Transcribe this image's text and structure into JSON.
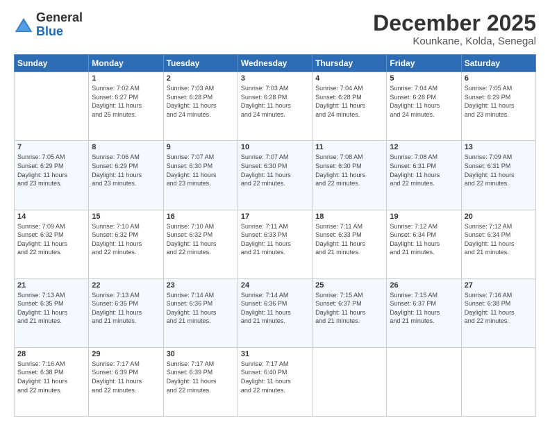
{
  "logo": {
    "line1": "General",
    "line2": "Blue"
  },
  "header": {
    "month": "December 2025",
    "location": "Kounkane, Kolda, Senegal"
  },
  "weekdays": [
    "Sunday",
    "Monday",
    "Tuesday",
    "Wednesday",
    "Thursday",
    "Friday",
    "Saturday"
  ],
  "weeks": [
    [
      {
        "day": "",
        "info": ""
      },
      {
        "day": "1",
        "info": "Sunrise: 7:02 AM\nSunset: 6:27 PM\nDaylight: 11 hours\nand 25 minutes."
      },
      {
        "day": "2",
        "info": "Sunrise: 7:03 AM\nSunset: 6:28 PM\nDaylight: 11 hours\nand 24 minutes."
      },
      {
        "day": "3",
        "info": "Sunrise: 7:03 AM\nSunset: 6:28 PM\nDaylight: 11 hours\nand 24 minutes."
      },
      {
        "day": "4",
        "info": "Sunrise: 7:04 AM\nSunset: 6:28 PM\nDaylight: 11 hours\nand 24 minutes."
      },
      {
        "day": "5",
        "info": "Sunrise: 7:04 AM\nSunset: 6:28 PM\nDaylight: 11 hours\nand 24 minutes."
      },
      {
        "day": "6",
        "info": "Sunrise: 7:05 AM\nSunset: 6:29 PM\nDaylight: 11 hours\nand 23 minutes."
      }
    ],
    [
      {
        "day": "7",
        "info": "Sunrise: 7:05 AM\nSunset: 6:29 PM\nDaylight: 11 hours\nand 23 minutes."
      },
      {
        "day": "8",
        "info": "Sunrise: 7:06 AM\nSunset: 6:29 PM\nDaylight: 11 hours\nand 23 minutes."
      },
      {
        "day": "9",
        "info": "Sunrise: 7:07 AM\nSunset: 6:30 PM\nDaylight: 11 hours\nand 23 minutes."
      },
      {
        "day": "10",
        "info": "Sunrise: 7:07 AM\nSunset: 6:30 PM\nDaylight: 11 hours\nand 22 minutes."
      },
      {
        "day": "11",
        "info": "Sunrise: 7:08 AM\nSunset: 6:30 PM\nDaylight: 11 hours\nand 22 minutes."
      },
      {
        "day": "12",
        "info": "Sunrise: 7:08 AM\nSunset: 6:31 PM\nDaylight: 11 hours\nand 22 minutes."
      },
      {
        "day": "13",
        "info": "Sunrise: 7:09 AM\nSunset: 6:31 PM\nDaylight: 11 hours\nand 22 minutes."
      }
    ],
    [
      {
        "day": "14",
        "info": "Sunrise: 7:09 AM\nSunset: 6:32 PM\nDaylight: 11 hours\nand 22 minutes."
      },
      {
        "day": "15",
        "info": "Sunrise: 7:10 AM\nSunset: 6:32 PM\nDaylight: 11 hours\nand 22 minutes."
      },
      {
        "day": "16",
        "info": "Sunrise: 7:10 AM\nSunset: 6:32 PM\nDaylight: 11 hours\nand 22 minutes."
      },
      {
        "day": "17",
        "info": "Sunrise: 7:11 AM\nSunset: 6:33 PM\nDaylight: 11 hours\nand 21 minutes."
      },
      {
        "day": "18",
        "info": "Sunrise: 7:11 AM\nSunset: 6:33 PM\nDaylight: 11 hours\nand 21 minutes."
      },
      {
        "day": "19",
        "info": "Sunrise: 7:12 AM\nSunset: 6:34 PM\nDaylight: 11 hours\nand 21 minutes."
      },
      {
        "day": "20",
        "info": "Sunrise: 7:12 AM\nSunset: 6:34 PM\nDaylight: 11 hours\nand 21 minutes."
      }
    ],
    [
      {
        "day": "21",
        "info": "Sunrise: 7:13 AM\nSunset: 6:35 PM\nDaylight: 11 hours\nand 21 minutes."
      },
      {
        "day": "22",
        "info": "Sunrise: 7:13 AM\nSunset: 6:35 PM\nDaylight: 11 hours\nand 21 minutes."
      },
      {
        "day": "23",
        "info": "Sunrise: 7:14 AM\nSunset: 6:36 PM\nDaylight: 11 hours\nand 21 minutes."
      },
      {
        "day": "24",
        "info": "Sunrise: 7:14 AM\nSunset: 6:36 PM\nDaylight: 11 hours\nand 21 minutes."
      },
      {
        "day": "25",
        "info": "Sunrise: 7:15 AM\nSunset: 6:37 PM\nDaylight: 11 hours\nand 21 minutes."
      },
      {
        "day": "26",
        "info": "Sunrise: 7:15 AM\nSunset: 6:37 PM\nDaylight: 11 hours\nand 21 minutes."
      },
      {
        "day": "27",
        "info": "Sunrise: 7:16 AM\nSunset: 6:38 PM\nDaylight: 11 hours\nand 22 minutes."
      }
    ],
    [
      {
        "day": "28",
        "info": "Sunrise: 7:16 AM\nSunset: 6:38 PM\nDaylight: 11 hours\nand 22 minutes."
      },
      {
        "day": "29",
        "info": "Sunrise: 7:17 AM\nSunset: 6:39 PM\nDaylight: 11 hours\nand 22 minutes."
      },
      {
        "day": "30",
        "info": "Sunrise: 7:17 AM\nSunset: 6:39 PM\nDaylight: 11 hours\nand 22 minutes."
      },
      {
        "day": "31",
        "info": "Sunrise: 7:17 AM\nSunset: 6:40 PM\nDaylight: 11 hours\nand 22 minutes."
      },
      {
        "day": "",
        "info": ""
      },
      {
        "day": "",
        "info": ""
      },
      {
        "day": "",
        "info": ""
      }
    ]
  ]
}
